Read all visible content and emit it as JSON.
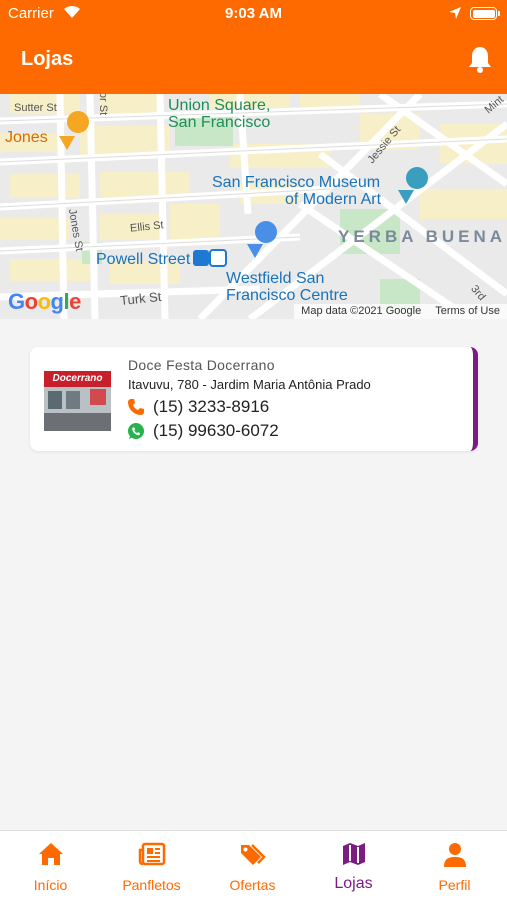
{
  "status_bar": {
    "carrier": "Carrier",
    "time": "9:03 AM"
  },
  "header": {
    "title": "Lojas",
    "bell_icon": "bell-icon"
  },
  "map": {
    "labels": {
      "sutter": "Sutter St",
      "stockton": "tor St",
      "union_square_1": "Union Square,",
      "union_square_2": "San Francisco",
      "jones_place": "Jones",
      "jessie": "Jessie St",
      "sfmoma_1": "San Francisco Museum",
      "sfmoma_2": "of Modern Art",
      "ellis": "Ellis St",
      "jones_st": "Jones St",
      "yerba_buena": "YERBA BUENA",
      "powell": "Powell Street",
      "westfield_1": "Westfield San",
      "westfield_2": "Francisco Centre",
      "turk": "Turk St",
      "mint": "Mint",
      "third": "3rd"
    },
    "logo": [
      "G",
      "o",
      "o",
      "g",
      "l",
      "e"
    ],
    "attribution": "Map data ©2021 Google",
    "terms": "Terms of Use"
  },
  "store": {
    "name": "Doce Festa Docerrano",
    "address": "Itavuvu, 780 - Jardim Maria Antônia Prado",
    "phone": "(15) 3233-8916",
    "whatsapp": "(15) 99630-6072",
    "thumb_sign": "Docerrano",
    "accent": "#7b1c83"
  },
  "nav": [
    {
      "label": "Início",
      "icon": "home-icon"
    },
    {
      "label": "Panfletos",
      "icon": "newspaper-icon"
    },
    {
      "label": "Ofertas",
      "icon": "tag-icon"
    },
    {
      "label": "Lojas",
      "icon": "map-icon",
      "active": true
    },
    {
      "label": "Perfil",
      "icon": "user-icon"
    }
  ],
  "colors": {
    "primary": "#ff6a00",
    "active": "#7b1c83"
  }
}
